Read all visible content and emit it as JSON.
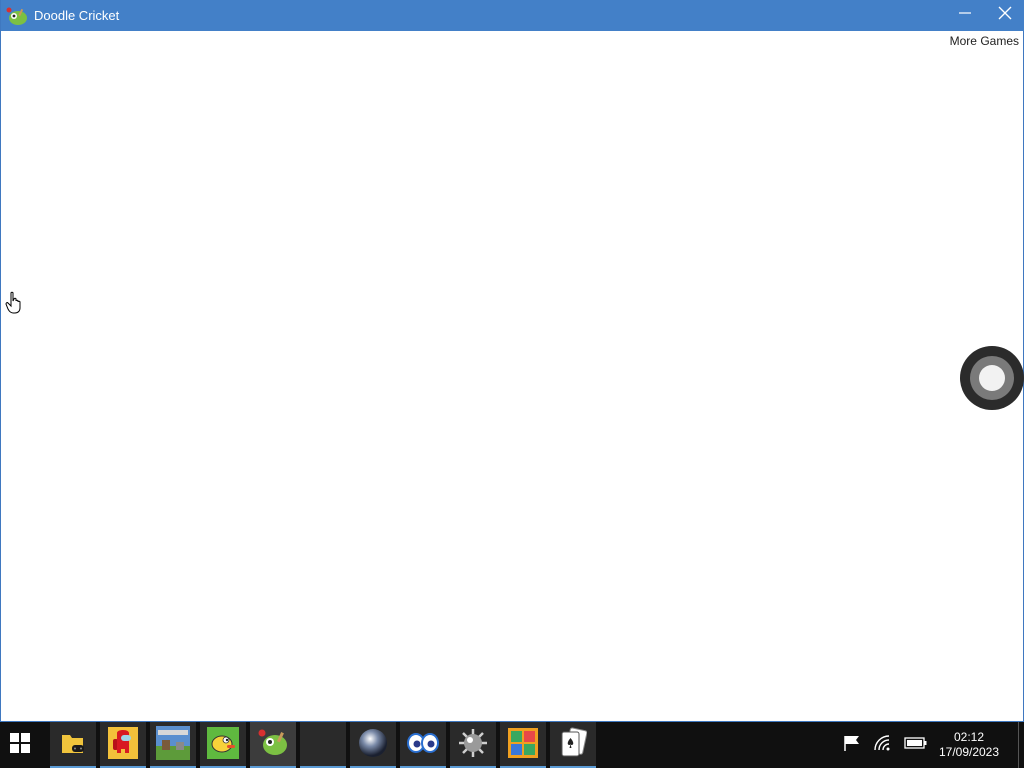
{
  "window": {
    "title": "Doodle Cricket",
    "app_icon": "doodle-cricket-icon",
    "minimize_icon": "minimize-icon",
    "close_icon": "close-icon"
  },
  "content": {
    "more_games_label": "More Games",
    "round_button_icon": "circle-button-icon"
  },
  "taskbar": {
    "start_icon": "windows-start-icon",
    "apps": [
      {
        "name": "file-explorer-gaming",
        "icon": "folder-gamepad-icon"
      },
      {
        "name": "among-us",
        "icon": "among-us-icon"
      },
      {
        "name": "minecraft",
        "icon": "minecraft-icon"
      },
      {
        "name": "flappy-bird",
        "icon": "flappy-bird-icon"
      },
      {
        "name": "doodle-cricket",
        "icon": "doodle-cricket-icon"
      },
      {
        "name": "blank-app",
        "icon": "blank-icon"
      },
      {
        "name": "marble",
        "icon": "marble-icon"
      },
      {
        "name": "eyes",
        "icon": "eyes-icon"
      },
      {
        "name": "minesweeper",
        "icon": "mine-icon"
      },
      {
        "name": "color-blocks",
        "icon": "blocks-icon"
      },
      {
        "name": "solitaire",
        "icon": "cards-icon"
      }
    ],
    "tray": {
      "flag_icon": "flag-icon",
      "network_icon": "wifi-icon",
      "battery_icon": "battery-icon"
    },
    "clock": {
      "time": "02:12",
      "date": "17/09/2023"
    }
  },
  "colors": {
    "titlebar": "#4380c8",
    "taskbar": "#101010",
    "accent_underline": "#5b9bd5"
  }
}
